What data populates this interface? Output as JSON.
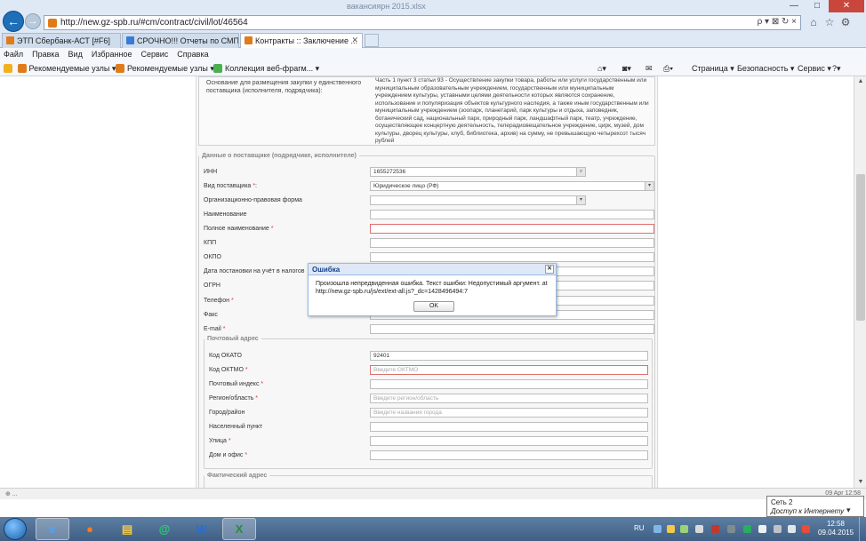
{
  "window": {
    "title": "вакансиярн 2015.xlsx",
    "address": "http://new.gz-spb.ru/#cm/contract/civil/lot/46564",
    "address_right": "ρ ▾ ⊠ ↻ ×"
  },
  "tabs": [
    {
      "label": "ЭТП Сбербанк-АСТ [#F6]"
    },
    {
      "label": "СРОЧНО!!! Отчеты по СМП и..."
    },
    {
      "label": "Контракты :: Заключение ..."
    }
  ],
  "menu": [
    "Файл",
    "Правка",
    "Вид",
    "Избранное",
    "Сервис",
    "Справка"
  ],
  "favorites": {
    "items": [
      "Рекомендуемые узлы ▾",
      "Рекомендуемые узлы ▾",
      "Коллекция веб-фрагм... ▾"
    ],
    "commands": [
      "Страница ▾",
      "Безопасность ▾",
      "Сервис ▾"
    ]
  },
  "form": {
    "basis_label": "Основание для размещения закупки у единственного поставщика (исполнителя, подрядчика):",
    "basis_text": "Часть 1 пункт 3 статьи 93 - Осуществление закупки товара, работы или услуги государственным или муниципальным образовательным учреждением, государственным или муниципальным учреждением культуры, уставными целями деятельности которых являются сохранение, использование и популяризация объектов культурного наследия, а также иным государственным или муниципальным учреждением (зоопарк, планетарий, парк культуры и отдыха, заповедник, ботанический сад, национальный парк, природный парк, ландшафтный парк, театр, учреждение, осуществляющее концертную деятельность, телерадиовещательное учреждение, цирк, музей, дом культуры, дворец культуры, клуб, библиотека, архив) на сумму, не превышающую четырехсот тысяч рублей",
    "supplier_section": "Данные о поставщике (подрядчике, исполнителе)",
    "fields": {
      "inn": {
        "label": "ИНН",
        "value": "1655272536"
      },
      "supplier_type": {
        "label": "Вид поставщика",
        "value": "Юридическое лицо (РФ)"
      },
      "org_form": {
        "label": "Организационно-правовая форма",
        "value": ""
      },
      "name": {
        "label": "Наименование",
        "value": ""
      },
      "full_name": {
        "label": "Полное наименование",
        "value": ""
      },
      "kpp": {
        "label": "КПП",
        "value": ""
      },
      "okpo": {
        "label": "ОКПО",
        "value": ""
      },
      "tax_date": {
        "label": "Дата постановки на учёт в налогов",
        "value": ""
      },
      "ogrn": {
        "label": "ОГРН",
        "value": ""
      },
      "phone": {
        "label": "Телефон",
        "value": ""
      },
      "fax": {
        "label": "Факс",
        "value": ""
      },
      "email": {
        "label": "E-mail",
        "value": ""
      }
    },
    "postal_section": "Почтовый адрес",
    "postal": {
      "okato": {
        "label": "Код ОКАТО",
        "value": "92401"
      },
      "oktmo": {
        "label": "Код ОКТМО",
        "placeholder": "Введите ОКТМО"
      },
      "index": {
        "label": "Почтовый индекс",
        "value": ""
      },
      "region": {
        "label": "Регион/область",
        "placeholder": "Введите регион/область"
      },
      "city": {
        "label": "Город/район",
        "placeholder": "Введите названия города"
      },
      "settlement": {
        "label": "Населенный пункт",
        "value": ""
      },
      "street": {
        "label": "Улица",
        "value": ""
      },
      "house": {
        "label": "Дом и офис",
        "value": ""
      }
    },
    "actual_section": "Фактический адрес",
    "required_mark": "*"
  },
  "modal": {
    "title": "Ошибка",
    "message": "Произошла непредвиденная ошибка. Текст ошибки: Недопустимый аргумент. at http://new.gz-spb.ru/js/ext/ext-all.js?_dc=1428496494:7",
    "ok_label": "OK"
  },
  "status": {
    "left": "⊕ ...",
    "right": "09 Apr 12:58"
  },
  "network_tip": {
    "line1": "Сеть  2",
    "line2": "Доступ к Интернету"
  },
  "taskbar": {
    "lang": "RU",
    "time": "12:58",
    "date": "09.04.2015"
  }
}
